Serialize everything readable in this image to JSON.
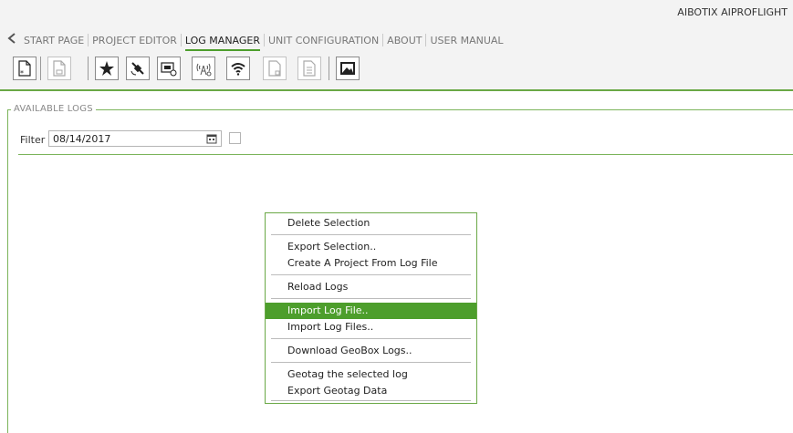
{
  "app": {
    "title": "AIBOTIX AIPROFLIGHT"
  },
  "nav": {
    "items": [
      {
        "label": "START PAGE"
      },
      {
        "label": "PROJECT EDITOR"
      },
      {
        "label": "LOG MANAGER",
        "active": true
      },
      {
        "label": "UNIT CONFIGURATION"
      },
      {
        "label": "ABOUT"
      },
      {
        "label": "USER MANUAL"
      }
    ]
  },
  "toolbar": {
    "buttons": [
      "new-file-icon",
      "file-disabled-icon",
      "star-icon",
      "satellite-icon",
      "gps-monitor-icon",
      "antenna-icon",
      "wifi-icon",
      "file-copy-disabled-icon",
      "document-disabled-icon",
      "image-icon"
    ]
  },
  "section": {
    "label": "AVAILABLE LOGS"
  },
  "filter": {
    "label": "Filter",
    "value": "08/14/2017"
  },
  "context_menu": {
    "items": [
      "Delete Selection",
      "Export Selection..",
      "Create A Project From Log File",
      "Reload Logs",
      "Import Log File..",
      "Import Log Files..",
      "Download GeoBox Logs..",
      "Geotag the selected log",
      "Export Geotag Data"
    ],
    "highlighted": "Import Log File.."
  },
  "colors": {
    "accent": "#4d9e2c",
    "line": "#7bb45a",
    "title_bar": "#f3f3f3"
  }
}
